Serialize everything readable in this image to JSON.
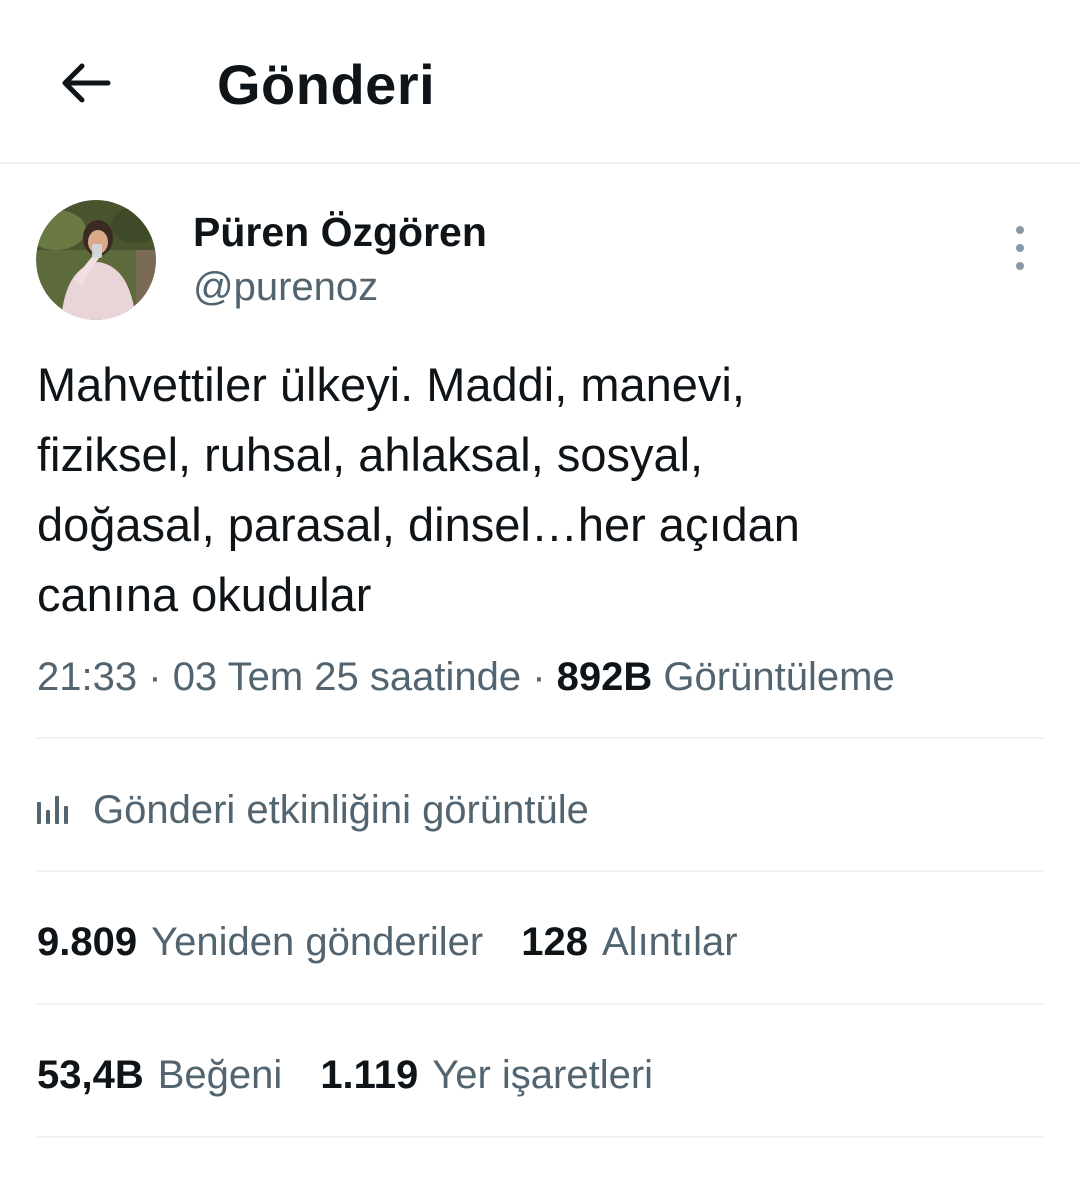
{
  "header": {
    "title": "Gönderi",
    "back_icon": "arrow-left-icon"
  },
  "author": {
    "name": "Püren Özgören",
    "handle": "@purenoz",
    "more_icon": "more-vertical-icon"
  },
  "post": {
    "text": "Mahvettiler ülkeyi. Maddi, manevi,\nfiziksel, ruhsal, ahlaksal, sosyal,\ndoğasal, parasal, dinsel…her açıdan\ncanına okudular"
  },
  "meta": {
    "time": "21:33",
    "separator": "·",
    "date": "03 Tem 25 saatinde",
    "views_count": "892B",
    "views_label": "Görüntüleme"
  },
  "activity": {
    "icon": "analytics-bar-icon",
    "label": "Gönderi etkinliğini görüntüle"
  },
  "stats": {
    "reposts_count": "9.809",
    "reposts_label": "Yeniden gönderiler",
    "quotes_count": "128",
    "quotes_label": "Alıntılar",
    "likes_count": "53,4B",
    "likes_label": "Beğeni",
    "bookmarks_count": "1.119",
    "bookmarks_label": "Yer işaretleri"
  },
  "colors": {
    "text_primary": "#0f1419",
    "text_secondary": "#536471",
    "divider": "#eff3f4"
  }
}
